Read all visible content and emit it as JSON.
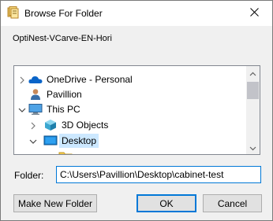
{
  "window": {
    "title": "Browse For Folder",
    "description": "OptiNest-VCarve-EN-Hori"
  },
  "tree": {
    "items": [
      {
        "label": "OneDrive - Personal",
        "icon": "onedrive-cloud-icon",
        "expanded": false,
        "indent": 0
      },
      {
        "label": "Pavillion",
        "icon": "user-folder-icon",
        "expanded": null,
        "indent": 0
      },
      {
        "label": "This PC",
        "icon": "computer-icon",
        "expanded": true,
        "indent": 0
      },
      {
        "label": "3D Objects",
        "icon": "3d-objects-folder-icon",
        "expanded": false,
        "indent": 1
      },
      {
        "label": "Desktop",
        "icon": "desktop-folder-icon",
        "expanded": true,
        "indent": 1,
        "selected": true
      }
    ]
  },
  "folder": {
    "label": "Folder:",
    "value": "C:\\Users\\Pavillion\\Desktop\\cabinet-test"
  },
  "buttons": {
    "make_new_folder": "Make New Folder",
    "ok": "OK",
    "cancel": "Cancel"
  },
  "colors": {
    "selection": "#cce8ff",
    "accent": "#0078d7"
  }
}
